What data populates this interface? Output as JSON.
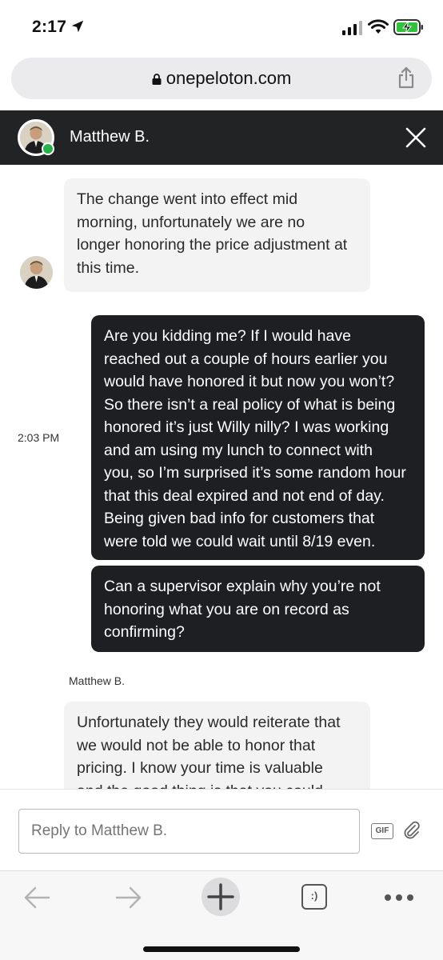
{
  "status_bar": {
    "time": "2:17",
    "icons": [
      "location-arrow-icon",
      "cellular-signal-icon",
      "wifi-icon",
      "battery-charging-icon"
    ]
  },
  "browser": {
    "url": "onepeloton.com",
    "icons": [
      "lock-icon",
      "share-icon"
    ]
  },
  "chat_header": {
    "agent_name": "Matthew B.",
    "status_color": "#27b24a",
    "close_icon": "close-icon"
  },
  "messages": [
    {
      "sender": "agent",
      "lines": [
        "The change went into effect mid",
        "morning, unfortunately we are no",
        "longer honoring the price adjustment at",
        "this time."
      ]
    },
    {
      "sender": "user",
      "timestamp": "2:03 PM",
      "lines": [
        "Are you kidding me? If I would have",
        "reached out a couple of hours earlier you",
        "would have honored it but now you won’t?",
        "So there isn’t a real policy of what is being",
        "honored it’s just Willy nilly? I was working",
        "and am using my lunch to connect with",
        "you, so I’m surprised it’s some random hour",
        "that this deal expired and not end of day.",
        "Being given bad info for customers that",
        "were told we could wait until 8/19 even."
      ]
    },
    {
      "sender": "user",
      "lines": [
        "Can a supervisor explain why you’re not",
        "honoring what you are on record as",
        "confirming?"
      ]
    },
    {
      "sender": "agent",
      "sender_label": "Matthew B.",
      "lines": [
        "Unfortunately they would reiterate that",
        "we would not be able to honor that",
        "pricing. I know your time is valuable",
        "and the good thing is that you could"
      ]
    }
  ],
  "reply": {
    "placeholder": "Reply to Matthew B.",
    "gif_label": "GIF",
    "attach_icon": "paperclip-icon"
  },
  "toolbar": {
    "tabs_label": ":)",
    "icons": [
      "back-arrow-icon",
      "forward-arrow-icon",
      "new-tab-plus-icon",
      "tabs-icon",
      "more-dots-icon"
    ]
  },
  "colors": {
    "header_bg": "#222325",
    "user_bubble_bg": "#1e1f22",
    "agent_bubble_bg": "#f3f3f4",
    "online": "#27b24a"
  }
}
